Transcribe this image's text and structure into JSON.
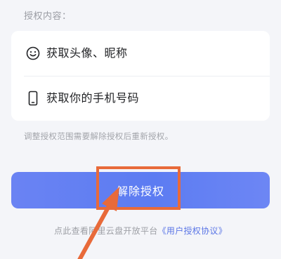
{
  "section_label": "授权内容：",
  "permissions": [
    {
      "icon": "smiley-icon",
      "label": "获取头像、昵称"
    },
    {
      "icon": "phone-icon",
      "label": "获取你的手机号码"
    }
  ],
  "hint": "调整授权范围需要解除授权后重新授权。",
  "revoke_button": {
    "label": "解除授权"
  },
  "footer": {
    "prefix": "点此查看阿里云盘开放平台",
    "link": "《用户授权协议》"
  },
  "colors": {
    "button": "#5c7cf2",
    "highlight": "#e86a3a",
    "link": "#5b76e6"
  }
}
